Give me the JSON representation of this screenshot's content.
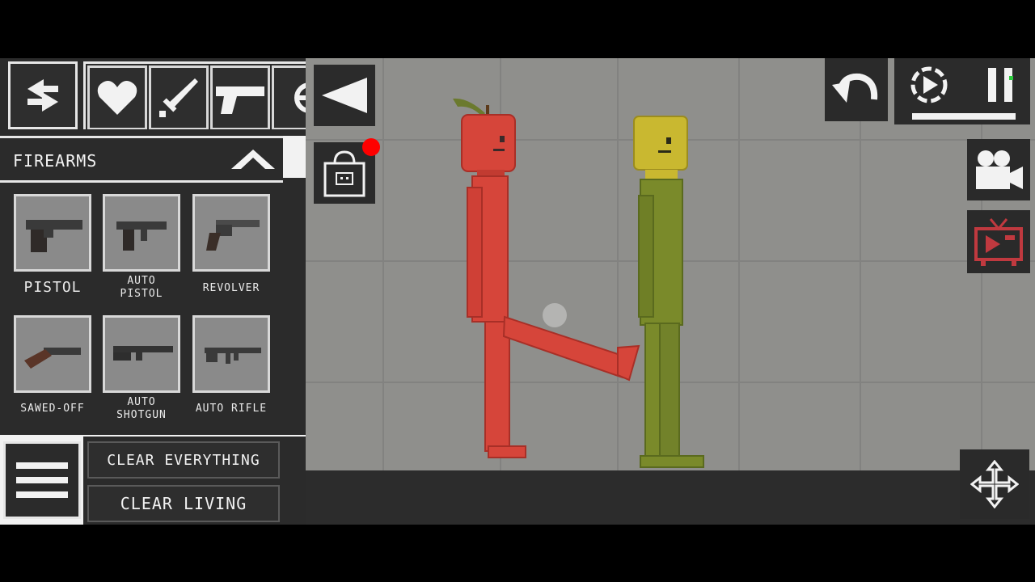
{
  "toolbar": {
    "swap_icon": "swap-arrows-icon",
    "categories": [
      {
        "icon": "heart-icon"
      },
      {
        "icon": "sword-icon"
      },
      {
        "icon": "pistol-icon"
      },
      {
        "icon": "partial-category-icon"
      }
    ]
  },
  "category_panel": {
    "title": "FIREARMS",
    "collapse_icon": "chevron-up-icon",
    "items": [
      {
        "label": "PISTOL",
        "icon": "pistol-icon"
      },
      {
        "label": "AUTO\nPISTOL",
        "icon": "auto-pistol-icon"
      },
      {
        "label": "REVOLVER",
        "icon": "revolver-icon"
      },
      {
        "label": "SAWED-OFF",
        "icon": "sawed-off-icon"
      },
      {
        "label": "AUTO\nSHOTGUN",
        "icon": "auto-shotgun-icon"
      },
      {
        "label": "AUTO RIFLE",
        "icon": "auto-rifle-icon"
      }
    ]
  },
  "bottom": {
    "menu_icon": "hamburger-menu-icon",
    "clear_everything": "CLEAR EVERYTHING",
    "clear_living": "CLEAR LIVING"
  },
  "side_controls": {
    "collapse_icon": "triangle-left-icon",
    "shop_icon": "shopping-bag-icon",
    "notification_color": "#ff0000"
  },
  "top_right": {
    "undo_icon": "undo-icon",
    "slow_motion_icon": "slow-motion-icon",
    "pause_icon": "pause-icon",
    "camera_icon": "camera-icon",
    "tv_icon": "tv-icon",
    "move_icon": "move-arrows-icon"
  },
  "colors": {
    "apple_red": "#d6453a",
    "corn_green": "#7a8a2a",
    "corn_yellow": "#c9b830",
    "tv_red": "#c0393f"
  }
}
